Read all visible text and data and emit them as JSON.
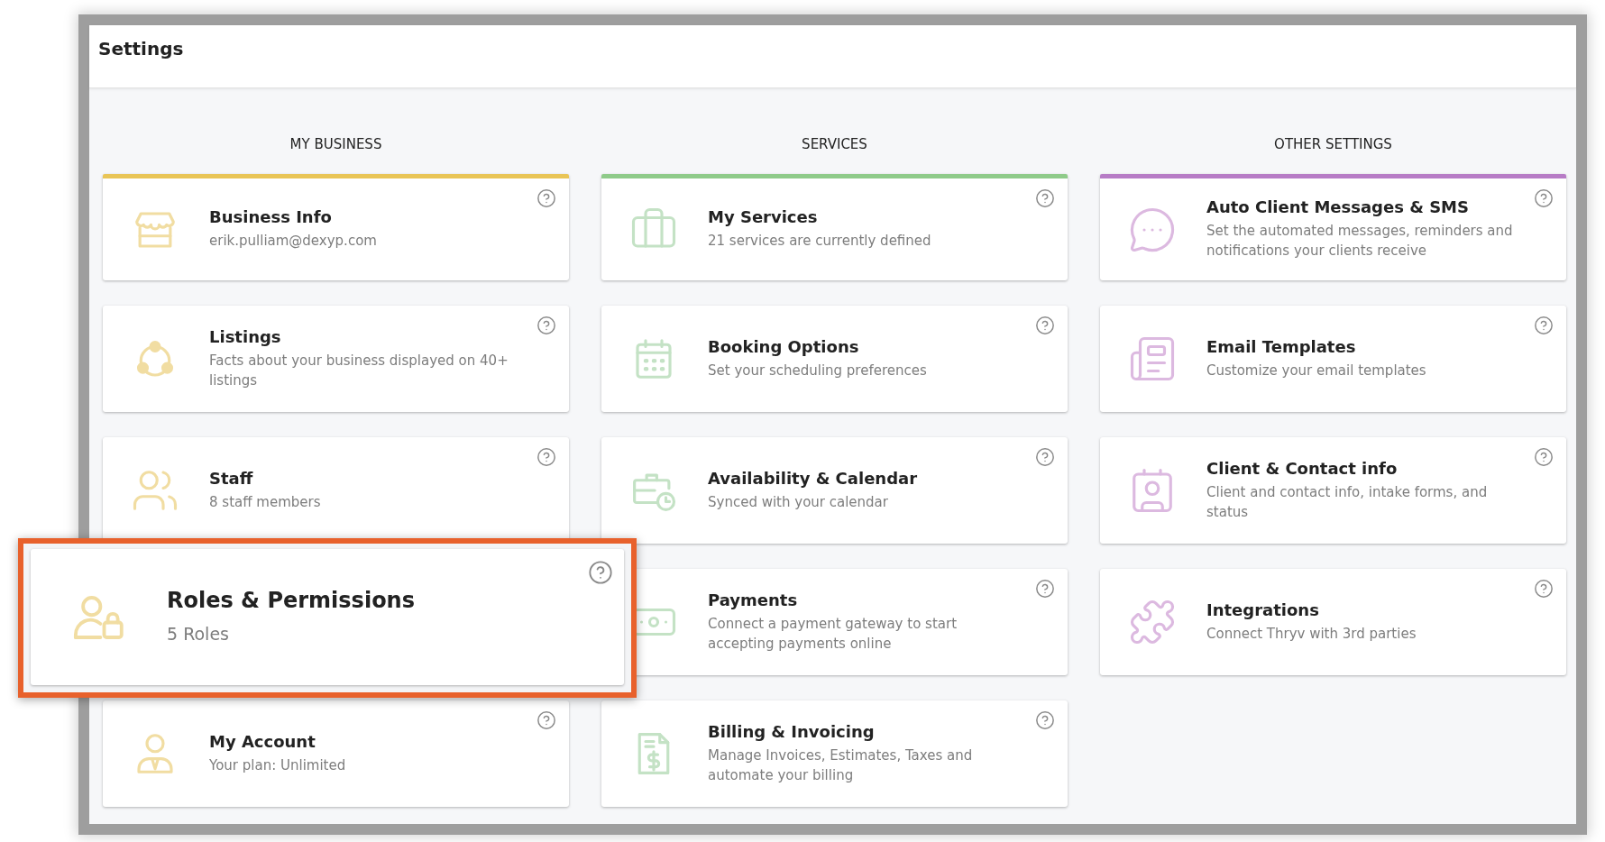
{
  "header": {
    "title": "Settings"
  },
  "columns": [
    {
      "title": "MY BUSINESS",
      "color": "#e9c557",
      "items": [
        {
          "title": "Business Info",
          "description": "erik.pulliam@dexyp.com",
          "highlighted": false
        },
        {
          "title": "Listings",
          "description": "Facts about your business displayed on 40+ listings",
          "highlighted": false
        },
        {
          "title": "Staff",
          "description": "8 staff members",
          "highlighted": false
        },
        {
          "title": "Roles & Permissions",
          "description": "5 Roles",
          "highlighted": true
        },
        {
          "title": "My Account",
          "description": "Your plan: Unlimited",
          "highlighted": false
        }
      ]
    },
    {
      "title": "SERVICES",
      "color": "#8fcb8a",
      "items": [
        {
          "title": "My Services",
          "description": "21 services are currently defined",
          "highlighted": false
        },
        {
          "title": "Booking Options",
          "description": "Set your scheduling preferences",
          "highlighted": false
        },
        {
          "title": "Availability & Calendar",
          "description": "Synced with your calendar",
          "highlighted": false
        },
        {
          "title": "Payments",
          "description": "Connect a payment gateway to start accepting payments online",
          "highlighted": false
        },
        {
          "title": "Billing & Invoicing",
          "description": "Manage Invoices, Estimates, Taxes and automate your billing",
          "highlighted": false
        }
      ]
    },
    {
      "title": "OTHER SETTINGS",
      "color": "#b77cc6",
      "items": [
        {
          "title": "Auto Client Messages & SMS",
          "description": "Set the automated messages, reminders and notifications your clients receive",
          "highlighted": false
        },
        {
          "title": "Email Templates",
          "description": "Customize your email templates",
          "highlighted": false
        },
        {
          "title": "Client & Contact info",
          "description": "Client and contact info, intake forms, and status",
          "highlighted": false
        },
        {
          "title": "Integrations",
          "description": "Connect Thryv with 3rd parties",
          "highlighted": false
        }
      ]
    }
  ]
}
